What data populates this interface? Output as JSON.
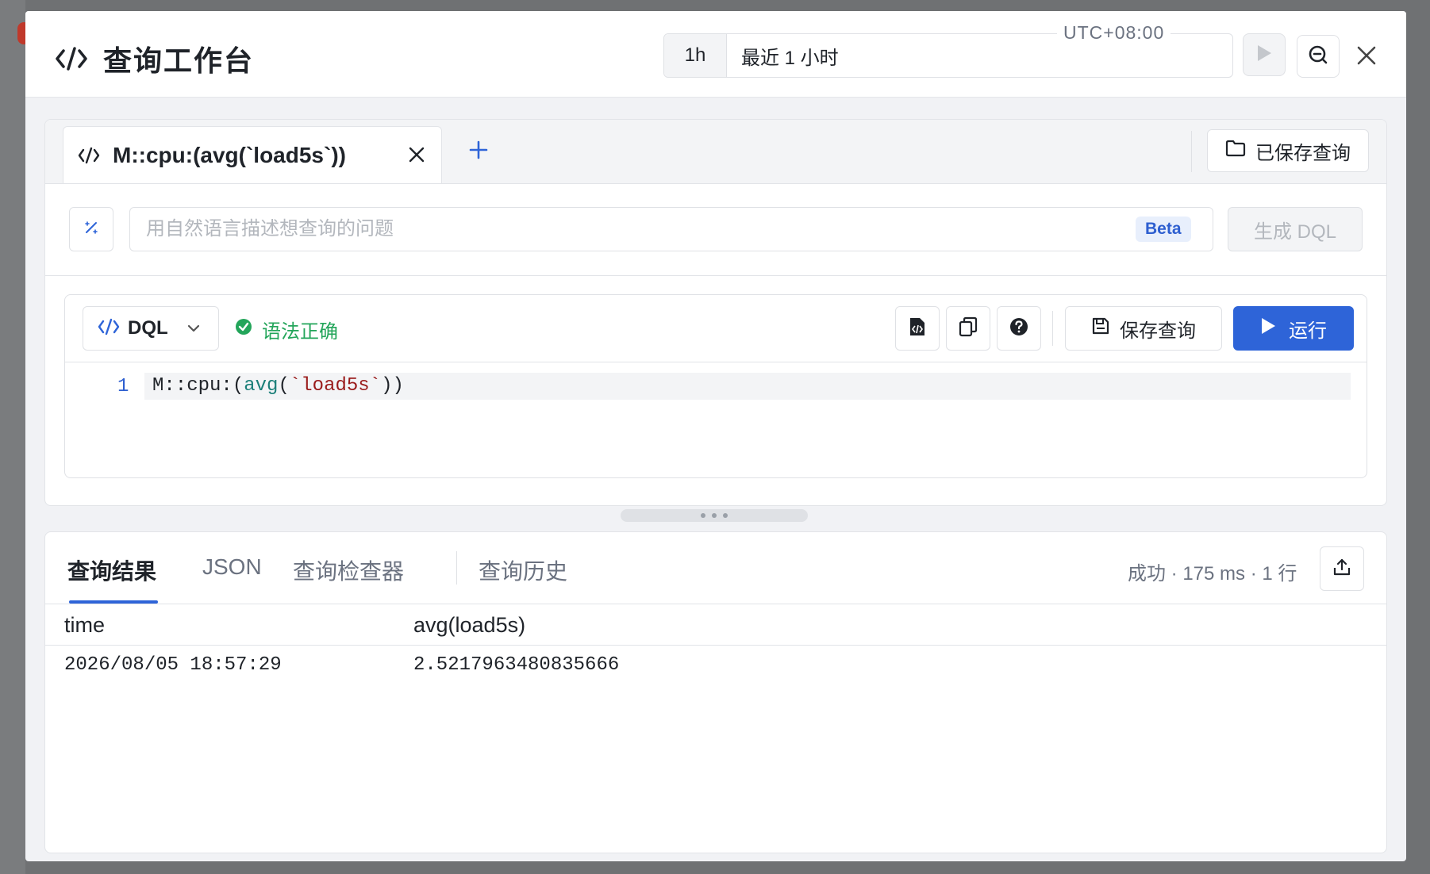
{
  "header": {
    "title": "查询工作台",
    "time_range_short": "1h",
    "time_range_label": "最近 1 小时",
    "timezone": "UTC+08:00"
  },
  "query_tabs": {
    "tabs": [
      {
        "label": "M::cpu:(avg(`load5s`))"
      }
    ],
    "saved_queries_label": "已保存查询"
  },
  "nl_query": {
    "placeholder": "用自然语言描述想查询的问题",
    "badge": "Beta",
    "generate_label": "生成 DQL"
  },
  "editor": {
    "language": "DQL",
    "syntax_status": "语法正确",
    "save_query_label": "保存查询",
    "run_label": "运行",
    "lines": [
      {
        "number": "1",
        "tokens": {
          "ns": "M::cpu:",
          "open": "(",
          "fn": "avg",
          "paren": "(",
          "str": "`load5s`",
          "close": "))"
        }
      }
    ]
  },
  "results": {
    "tabs": [
      "查询结果",
      "JSON",
      "查询检查器",
      "查询历史"
    ],
    "active_tab": "查询结果",
    "status": "成功 · 175 ms · 1 行",
    "columns": [
      "time",
      "avg(load5s)"
    ],
    "rows": [
      [
        "2026/08/05 18:57:29",
        "2.5217963480835666"
      ]
    ]
  },
  "colors": {
    "accent": "#2e64d8",
    "success": "#23a55a",
    "string_token": "#9a1b1b",
    "function_token": "#1b7f79"
  },
  "icons": {
    "title": "code-icon",
    "play": "play-icon",
    "zoom_out": "zoom-out-icon",
    "close": "close-icon",
    "add": "plus-icon",
    "folder": "folder-icon",
    "ai": "magic-wand-icon",
    "check": "check-circle-icon",
    "format": "code-file-icon",
    "copy": "copy-icon",
    "help": "help-icon",
    "save": "save-icon",
    "export": "export-icon"
  }
}
